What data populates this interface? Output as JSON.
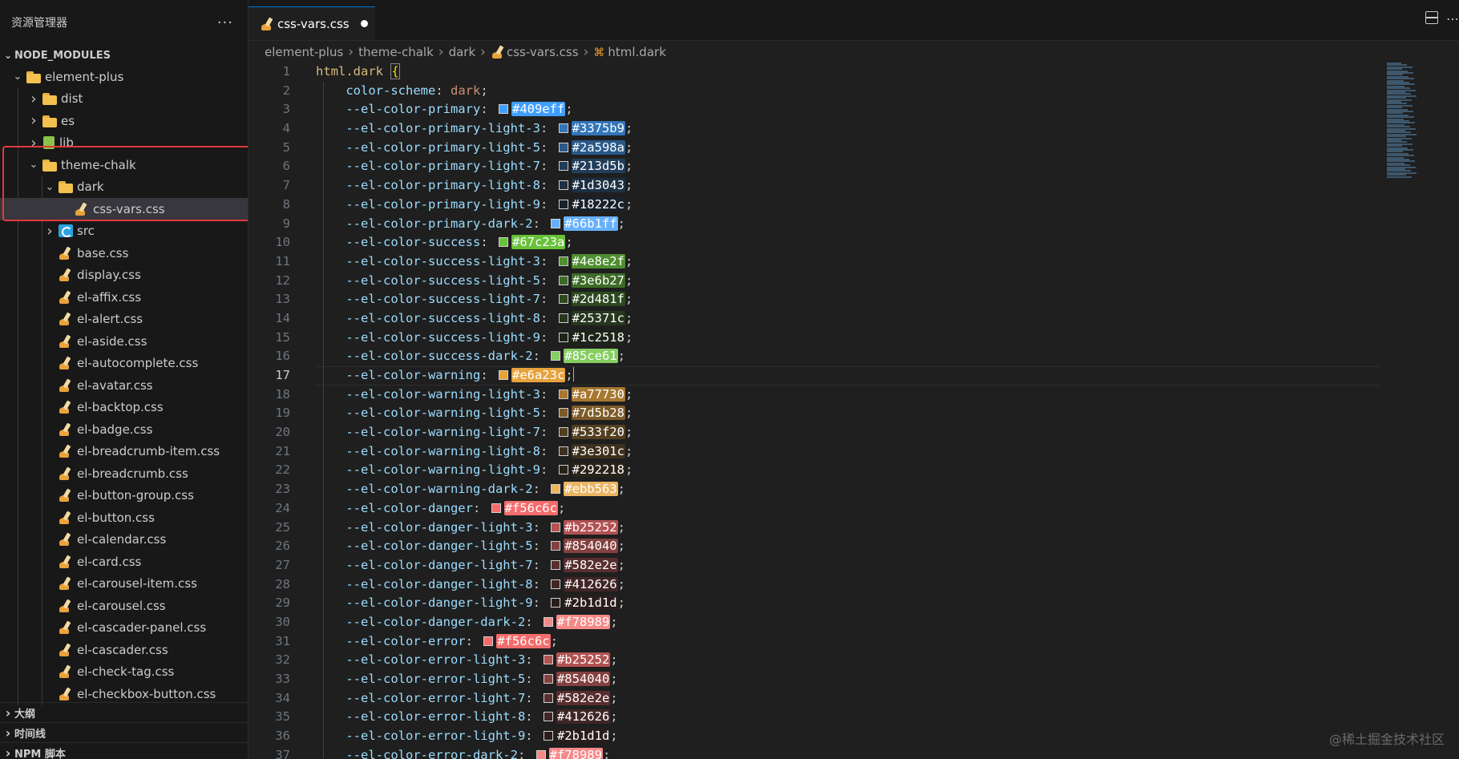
{
  "explorer": {
    "title": "资源管理器",
    "more": "···",
    "section": "NODE_MODULES",
    "tree": [
      {
        "label": "element-plus",
        "depth": 0,
        "type": "folder",
        "expanded": true
      },
      {
        "label": "dist",
        "depth": 1,
        "type": "folder",
        "expanded": false
      },
      {
        "label": "es",
        "depth": 1,
        "type": "folder",
        "expanded": false
      },
      {
        "label": "lib",
        "depth": 1,
        "type": "lib",
        "expanded": false
      },
      {
        "label": "theme-chalk",
        "depth": 1,
        "type": "folder",
        "expanded": true
      },
      {
        "label": "dark",
        "depth": 2,
        "type": "folder",
        "expanded": true
      },
      {
        "label": "css-vars.css",
        "depth": 3,
        "type": "css",
        "selected": true
      },
      {
        "label": "src",
        "depth": 2,
        "type": "src",
        "expanded": false
      },
      {
        "label": "base.css",
        "depth": 2,
        "type": "css"
      },
      {
        "label": "display.css",
        "depth": 2,
        "type": "css"
      },
      {
        "label": "el-affix.css",
        "depth": 2,
        "type": "css"
      },
      {
        "label": "el-alert.css",
        "depth": 2,
        "type": "css"
      },
      {
        "label": "el-aside.css",
        "depth": 2,
        "type": "css"
      },
      {
        "label": "el-autocomplete.css",
        "depth": 2,
        "type": "css"
      },
      {
        "label": "el-avatar.css",
        "depth": 2,
        "type": "css"
      },
      {
        "label": "el-backtop.css",
        "depth": 2,
        "type": "css"
      },
      {
        "label": "el-badge.css",
        "depth": 2,
        "type": "css"
      },
      {
        "label": "el-breadcrumb-item.css",
        "depth": 2,
        "type": "css"
      },
      {
        "label": "el-breadcrumb.css",
        "depth": 2,
        "type": "css"
      },
      {
        "label": "el-button-group.css",
        "depth": 2,
        "type": "css"
      },
      {
        "label": "el-button.css",
        "depth": 2,
        "type": "css"
      },
      {
        "label": "el-calendar.css",
        "depth": 2,
        "type": "css"
      },
      {
        "label": "el-card.css",
        "depth": 2,
        "type": "css"
      },
      {
        "label": "el-carousel-item.css",
        "depth": 2,
        "type": "css"
      },
      {
        "label": "el-carousel.css",
        "depth": 2,
        "type": "css"
      },
      {
        "label": "el-cascader-panel.css",
        "depth": 2,
        "type": "css"
      },
      {
        "label": "el-cascader.css",
        "depth": 2,
        "type": "css"
      },
      {
        "label": "el-check-tag.css",
        "depth": 2,
        "type": "css"
      },
      {
        "label": "el-checkbox-button.css",
        "depth": 2,
        "type": "css"
      }
    ],
    "bottom_sections": [
      "大纲",
      "时间线",
      "NPM 脚本"
    ]
  },
  "tab": {
    "label": "css-vars.css",
    "modified": true
  },
  "breadcrumb": [
    "element-plus",
    "theme-chalk",
    "dark",
    "css-vars.css",
    "html.dark"
  ],
  "editor": {
    "current_line": 17,
    "selector": "html.dark",
    "color_scheme_prop": "color-scheme",
    "color_scheme_value": "dark",
    "vars": [
      {
        "name": "--el-color-primary",
        "value": "#409eff",
        "bg": "#409eff"
      },
      {
        "name": "--el-color-primary-light-3",
        "value": "#3375b9",
        "bg": "#3375b9"
      },
      {
        "name": "--el-color-primary-light-5",
        "value": "#2a598a",
        "bg": "#2a598a"
      },
      {
        "name": "--el-color-primary-light-7",
        "value": "#213d5b",
        "bg": "#213d5b"
      },
      {
        "name": "--el-color-primary-light-8",
        "value": "#1d3043",
        "bg": "#1d3043"
      },
      {
        "name": "--el-color-primary-light-9",
        "value": "#18222c",
        "bg": "#18222c"
      },
      {
        "name": "--el-color-primary-dark-2",
        "value": "#66b1ff",
        "bg": "#66b1ff"
      },
      {
        "name": "--el-color-success",
        "value": "#67c23a",
        "bg": "#67c23a"
      },
      {
        "name": "--el-color-success-light-3",
        "value": "#4e8e2f",
        "bg": "#4e8e2f"
      },
      {
        "name": "--el-color-success-light-5",
        "value": "#3e6b27",
        "bg": "#3e6b27"
      },
      {
        "name": "--el-color-success-light-7",
        "value": "#2d481f",
        "bg": "#2d481f"
      },
      {
        "name": "--el-color-success-light-8",
        "value": "#25371c",
        "bg": "#25371c"
      },
      {
        "name": "--el-color-success-light-9",
        "value": "#1c2518",
        "bg": "#1c2518"
      },
      {
        "name": "--el-color-success-dark-2",
        "value": "#85ce61",
        "bg": "#85ce61"
      },
      {
        "name": "--el-color-warning",
        "value": "#e6a23c",
        "bg": "#e6a23c"
      },
      {
        "name": "--el-color-warning-light-3",
        "value": "#a77730",
        "bg": "#a77730"
      },
      {
        "name": "--el-color-warning-light-5",
        "value": "#7d5b28",
        "bg": "#7d5b28"
      },
      {
        "name": "--el-color-warning-light-7",
        "value": "#533f20",
        "bg": "#533f20"
      },
      {
        "name": "--el-color-warning-light-8",
        "value": "#3e301c",
        "bg": "#3e301c"
      },
      {
        "name": "--el-color-warning-light-9",
        "value": "#292218",
        "bg": "#292218"
      },
      {
        "name": "--el-color-warning-dark-2",
        "value": "#ebb563",
        "bg": "#ebb563"
      },
      {
        "name": "--el-color-danger",
        "value": "#f56c6c",
        "bg": "#f56c6c"
      },
      {
        "name": "--el-color-danger-light-3",
        "value": "#b25252",
        "bg": "#b25252"
      },
      {
        "name": "--el-color-danger-light-5",
        "value": "#854040",
        "bg": "#854040"
      },
      {
        "name": "--el-color-danger-light-7",
        "value": "#582e2e",
        "bg": "#582e2e"
      },
      {
        "name": "--el-color-danger-light-8",
        "value": "#412626",
        "bg": "#412626"
      },
      {
        "name": "--el-color-danger-light-9",
        "value": "#2b1d1d",
        "bg": "#2b1d1d"
      },
      {
        "name": "--el-color-danger-dark-2",
        "value": "#f78989",
        "bg": "#f78989"
      },
      {
        "name": "--el-color-error",
        "value": "#f56c6c",
        "bg": "#f56c6c"
      },
      {
        "name": "--el-color-error-light-3",
        "value": "#b25252",
        "bg": "#b25252"
      },
      {
        "name": "--el-color-error-light-5",
        "value": "#854040",
        "bg": "#854040"
      },
      {
        "name": "--el-color-error-light-7",
        "value": "#582e2e",
        "bg": "#582e2e"
      },
      {
        "name": "--el-color-error-light-8",
        "value": "#412626",
        "bg": "#412626"
      },
      {
        "name": "--el-color-error-light-9",
        "value": "#2b1d1d",
        "bg": "#2b1d1d"
      },
      {
        "name": "--el-color-error-dark-2",
        "value": "#f78989",
        "bg": "#f78989"
      }
    ]
  },
  "colors": {
    "selection_outline": "#e23a3a",
    "tab_accent": "#0078d4"
  },
  "watermark": "@稀土掘金技术社区"
}
